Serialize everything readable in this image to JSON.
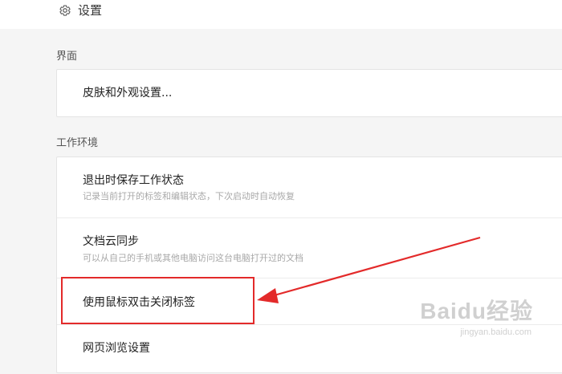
{
  "header": {
    "title": "设置",
    "icon": "gear-icon"
  },
  "sections": [
    {
      "label": "界面",
      "items": [
        {
          "label": "皮肤和外观设置..."
        }
      ]
    },
    {
      "label": "工作环境",
      "items": [
        {
          "label": "退出时保存工作状态",
          "description": "记录当前打开的标签和编辑状态，下次启动时自动恢复"
        },
        {
          "label": "文档云同步",
          "description": "可以从自己的手机或其他电脑访问这台电脑打开过的文档"
        },
        {
          "label": "使用鼠标双击关闭标签"
        },
        {
          "label": "网页浏览设置"
        }
      ]
    }
  ],
  "annotation": {
    "highlight_color": "#e32a2a",
    "highlighted_item": "使用鼠标双击关闭标签"
  },
  "watermark": {
    "main": "Baidu经验",
    "sub": "jingyan.baidu.com"
  },
  "colors": {
    "page_background": "#f5f5f5",
    "card_background": "#ffffff",
    "annotation_red": "#e32a2a"
  }
}
